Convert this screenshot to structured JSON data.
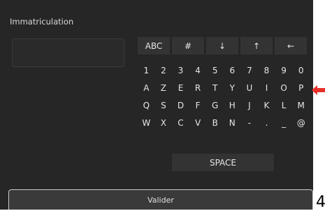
{
  "screen": {
    "title": "Immatriculation",
    "plate_value": "",
    "validate_label": "Valider"
  },
  "keyboard": {
    "top_row": [
      {
        "label": "ABC",
        "name": "key-abc"
      },
      {
        "label": "#",
        "name": "key-symbols"
      },
      {
        "label": "↓",
        "name": "key-arrow-down"
      },
      {
        "label": "↑",
        "name": "key-arrow-up"
      },
      {
        "label": "←",
        "name": "key-backspace"
      }
    ],
    "rows": [
      [
        "1",
        "2",
        "3",
        "4",
        "5",
        "6",
        "7",
        "8",
        "9",
        "0"
      ],
      [
        "A",
        "Z",
        "E",
        "R",
        "T",
        "Y",
        "U",
        "I",
        "O",
        "P"
      ],
      [
        "Q",
        "S",
        "D",
        "F",
        "G",
        "H",
        "J",
        "K",
        "L",
        "M"
      ],
      [
        "W",
        "X",
        "C",
        "V",
        "B",
        "N",
        "-",
        ".",
        "_",
        "@"
      ]
    ],
    "space_label": "SPACE"
  },
  "annotation": {
    "pointer_color": "#e8302a",
    "side_digit": "4"
  }
}
